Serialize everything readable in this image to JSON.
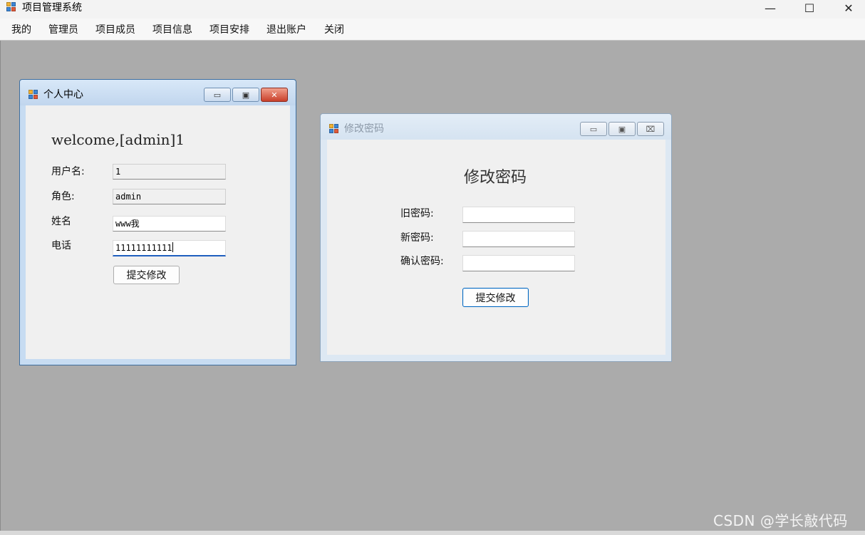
{
  "app": {
    "title": "项目管理系统"
  },
  "window_controls": {
    "minimize": "—",
    "maximize": "☐",
    "close": "✕"
  },
  "menu": {
    "items": [
      "我的",
      "管理员",
      "项目成员",
      "项目信息",
      "项目安排",
      "退出账户",
      "关闭"
    ]
  },
  "profile_window": {
    "title": "个人中心",
    "welcome": "welcome,[admin]1",
    "fields": {
      "username": {
        "label": "用户名:",
        "value": "1"
      },
      "role": {
        "label": "角色:",
        "value": "admin"
      },
      "name": {
        "label": "姓名",
        "value": "www我"
      },
      "phone": {
        "label": "电话",
        "value": "11111111111"
      }
    },
    "submit_label": "提交修改",
    "controls": {
      "minimize": "▭",
      "maximize": "▣",
      "close": "✕"
    }
  },
  "password_window": {
    "title": "修改密码",
    "heading": "修改密码",
    "fields": {
      "old": {
        "label": "旧密码:",
        "value": ""
      },
      "new": {
        "label": "新密码:",
        "value": ""
      },
      "confirm": {
        "label": "确认密码:",
        "value": ""
      }
    },
    "submit_label": "提交修改",
    "controls": {
      "minimize": "▭",
      "maximize": "▣",
      "close": "⌧"
    }
  },
  "watermark": "CSDN @学长敲代码",
  "colors": {
    "mdi_background": "#ababab",
    "active_border": "#3f6f9f",
    "focus_underline": "#1f5fbf",
    "close_button_red": "#c9402b"
  }
}
